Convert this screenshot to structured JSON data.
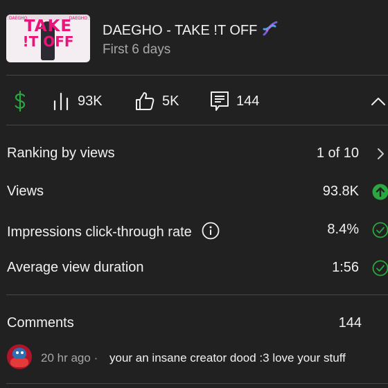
{
  "video": {
    "title": "DAEGHO - TAKE !T OFF",
    "title_emoji": "dna-icon",
    "period": "First 6 days",
    "thumbnail": {
      "text_line1": "TAKE",
      "text_line2": "!T OFF",
      "corner_left": "DAEGHO",
      "corner_right": "DAEGHO"
    }
  },
  "stats": {
    "revenue_icon": "dollar-icon",
    "views_icon": "bar-chart-icon",
    "views": "93K",
    "likes_icon": "thumbs-up-icon",
    "likes": "5K",
    "comments_icon": "comment-icon",
    "comments": "144",
    "collapse_icon": "chevron-up-icon"
  },
  "metrics": [
    {
      "label": "Ranking by views",
      "value": "1 of 10",
      "trail": "chevron-right-icon"
    },
    {
      "label": "Views",
      "value": "93.8K",
      "trail": "arrow-up-badge-icon"
    },
    {
      "label": "Impressions click-through rate",
      "value": "8.4%",
      "trail": "check-circle-icon",
      "info": "info-icon"
    },
    {
      "label": "Average view duration",
      "value": "1:56",
      "trail": "check-circle-icon"
    }
  ],
  "comments_section": {
    "label": "Comments",
    "count": "144",
    "top_comment": {
      "time": "20 hr ago",
      "separator": "·",
      "text": "your an insane creator dood :3 love your stuff"
    }
  },
  "colors": {
    "background": "#212121",
    "divider": "#474747",
    "accent_green": "#2ba640",
    "secondary_text": "#a8a8a8"
  }
}
